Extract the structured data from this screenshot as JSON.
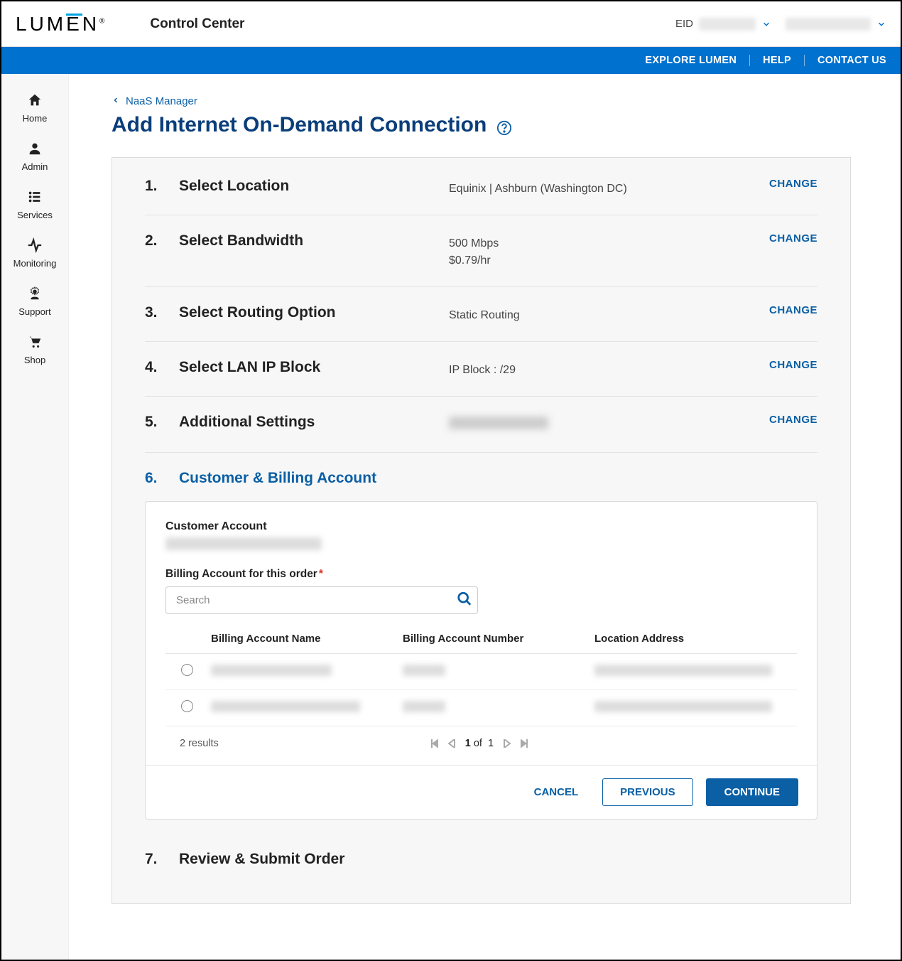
{
  "header": {
    "logo_text": "LUMEN",
    "app_name": "Control Center",
    "eid_label": "EID"
  },
  "blue_nav": {
    "explore": "EXPLORE LUMEN",
    "help": "HELP",
    "contact": "CONTACT US"
  },
  "sidebar": {
    "items": [
      {
        "label": "Home"
      },
      {
        "label": "Admin"
      },
      {
        "label": "Services"
      },
      {
        "label": "Monitoring"
      },
      {
        "label": "Support"
      },
      {
        "label": "Shop"
      }
    ]
  },
  "breadcrumb": {
    "back": "NaaS Manager"
  },
  "page_title": "Add Internet On-Demand Connection",
  "steps": {
    "s1": {
      "num": "1.",
      "label": "Select Location",
      "value": "Equinix | Ashburn (Washington DC)",
      "change": "CHANGE"
    },
    "s2": {
      "num": "2.",
      "label": "Select Bandwidth",
      "value_line1": "500 Mbps",
      "value_line2": "$0.79/hr",
      "change": "CHANGE"
    },
    "s3": {
      "num": "3.",
      "label": "Select Routing Option",
      "value": "Static Routing",
      "change": "CHANGE"
    },
    "s4": {
      "num": "4.",
      "label": "Select LAN IP Block",
      "value": "IP Block : /29",
      "change": "CHANGE"
    },
    "s5": {
      "num": "5.",
      "label": "Additional Settings",
      "change": "CHANGE"
    },
    "s6": {
      "num": "6.",
      "label": "Customer & Billing Account"
    },
    "s7": {
      "num": "7.",
      "label": "Review & Submit Order"
    }
  },
  "billing": {
    "customer_account_label": "Customer Account",
    "billing_account_label": "Billing Account for this order",
    "search_placeholder": "Search",
    "columns": {
      "name": "Billing Account Name",
      "number": "Billing Account Number",
      "address": "Location Address"
    },
    "results_text": "2 results",
    "page_text": "1 of 1",
    "actions": {
      "cancel": "CANCEL",
      "previous": "PREVIOUS",
      "continue": "CONTINUE"
    }
  }
}
